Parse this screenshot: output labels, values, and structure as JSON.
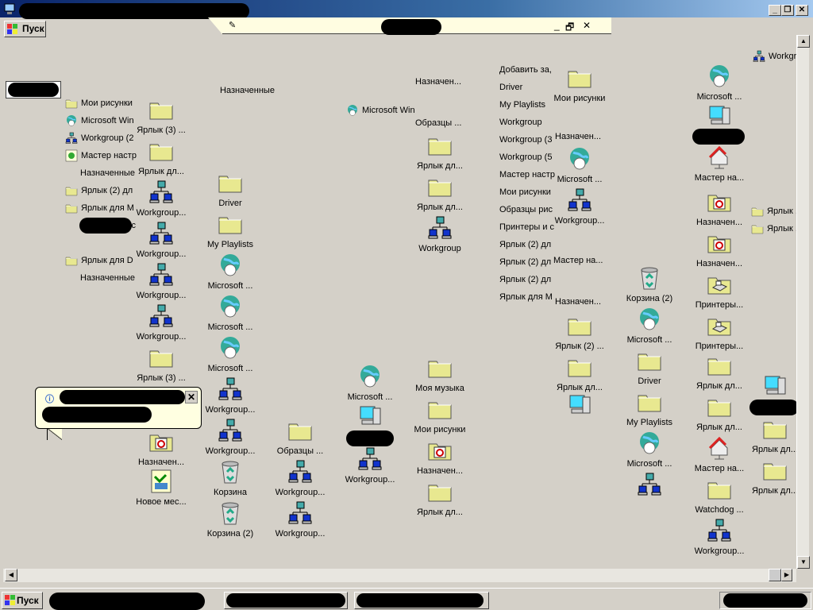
{
  "window": {
    "minimize": "_",
    "restore": "❐",
    "close": "✕"
  },
  "start": {
    "label": "Пуск"
  },
  "toolbar": {
    "minimize": "_",
    "restore": "🗗",
    "close": "✕"
  },
  "taskbar": {
    "start_label": "Пуск"
  },
  "balloon": {
    "close": "✕",
    "icon": "info-icon"
  },
  "text_items": [
    "Назначенные",
    "Назначен...",
    "Образцы ...",
    "Назначен...",
    "Мастер на...",
    "Назначен...",
    "Добавить за,",
    "Driver",
    "My Playlists",
    "Workgroup",
    "Workgroup (3",
    "Workgroup (5",
    "Мастер настр",
    "Мои рисунки",
    "Образцы рис",
    "Принтеры и с",
    "Ярлык (2) дл",
    "Ярлык (2) дл",
    "Ярлык (2) дл",
    "Ярлык для М",
    "Назначенные",
    "Назначенные"
  ],
  "small_icons": [
    {
      "label": "Мои рисунки",
      "icon": "folder"
    },
    {
      "label": "Microsoft Win",
      "icon": "globe"
    },
    {
      "label": "Workgroup (2",
      "icon": "network"
    },
    {
      "label": "Мастер настр",
      "icon": "wizard"
    },
    {
      "label": "Ярлык (2) дл",
      "icon": "folder"
    },
    {
      "label": "Ярлык для М",
      "icon": "folder"
    },
    {
      "label": "Принтеры и с",
      "icon": "none"
    },
    {
      "label": "Ярлык для D",
      "icon": "folder"
    },
    {
      "label": "Microsoft Win",
      "icon": "globe"
    },
    {
      "label": "Workgro",
      "icon": "network"
    },
    {
      "label": "Ярлык ,",
      "icon": "folder"
    },
    {
      "label": "Ярлык ,",
      "icon": "folder"
    }
  ],
  "large_icons": [
    {
      "label": "Ярлык (3) ...",
      "icon": "folder"
    },
    {
      "label": "Ярлык дл...",
      "icon": "folder"
    },
    {
      "label": "Workgroup...",
      "icon": "network"
    },
    {
      "label": "Workgroup...",
      "icon": "network"
    },
    {
      "label": "Workgroup...",
      "icon": "network"
    },
    {
      "label": "Workgroup...",
      "icon": "network"
    },
    {
      "label": "Ярлык (3) ...",
      "icon": "folder"
    },
    {
      "label": "Назначен...",
      "icon": "tasks"
    },
    {
      "label": "Новое мес...",
      "icon": "newplace"
    },
    {
      "label": "Driver",
      "icon": "folder"
    },
    {
      "label": "My Playlists",
      "icon": "folder"
    },
    {
      "label": "Microsoft ...",
      "icon": "globe"
    },
    {
      "label": "Microsoft ...",
      "icon": "globe"
    },
    {
      "label": "Microsoft ...",
      "icon": "globe"
    },
    {
      "label": "Workgroup...",
      "icon": "network"
    },
    {
      "label": "Workgroup...",
      "icon": "network"
    },
    {
      "label": "Корзина",
      "icon": "recycle"
    },
    {
      "label": "Корзина (2)",
      "icon": "recycle"
    },
    {
      "label": "Образцы ...",
      "icon": "folder"
    },
    {
      "label": "Workgroup...",
      "icon": "network"
    },
    {
      "label": "Workgroup...",
      "icon": "network"
    },
    {
      "label": "Microsoft ...",
      "icon": "globe"
    },
    {
      "label": "",
      "icon": "computer"
    },
    {
      "label": "Workgroup...",
      "icon": "network"
    },
    {
      "label": "Ярлык дл...",
      "icon": "folder"
    },
    {
      "label": "Ярлык дл...",
      "icon": "folder"
    },
    {
      "label": "Workgroup",
      "icon": "network"
    },
    {
      "label": "Моя музыка",
      "icon": "folder"
    },
    {
      "label": "Мои рисунки",
      "icon": "folder"
    },
    {
      "label": "Назначен...",
      "icon": "tasks"
    },
    {
      "label": "Ярлык дл...",
      "icon": "folder"
    },
    {
      "label": "Мои рисунки",
      "icon": "folder"
    },
    {
      "label": "Microsoft ...",
      "icon": "globe"
    },
    {
      "label": "Workgroup...",
      "icon": "network"
    },
    {
      "label": "Ярлык (2) ...",
      "icon": "folder"
    },
    {
      "label": "Ярлык дл...",
      "icon": "folder"
    },
    {
      "label": "",
      "icon": "computer"
    },
    {
      "label": "Корзина (2)",
      "icon": "recycle"
    },
    {
      "label": "Microsoft ...",
      "icon": "globe"
    },
    {
      "label": "Driver",
      "icon": "folder"
    },
    {
      "label": "My Playlists",
      "icon": "folder"
    },
    {
      "label": "Microsoft ...",
      "icon": "globe"
    },
    {
      "label": "",
      "icon": "network"
    },
    {
      "label": "Microsoft ...",
      "icon": "globe"
    },
    {
      "label": "",
      "icon": "computer"
    },
    {
      "label": "Мастер на...",
      "icon": "house"
    },
    {
      "label": "Назначен...",
      "icon": "tasks"
    },
    {
      "label": "Назначен...",
      "icon": "tasks"
    },
    {
      "label": "Принтеры...",
      "icon": "printers"
    },
    {
      "label": "Принтеры...",
      "icon": "printers"
    },
    {
      "label": "Ярлык дл...",
      "icon": "folder"
    },
    {
      "label": "Ярлык дл...",
      "icon": "folder"
    },
    {
      "label": "Мастер на...",
      "icon": "house"
    },
    {
      "label": "Watchdog ...",
      "icon": "folder"
    },
    {
      "label": "Workgroup...",
      "icon": "network"
    },
    {
      "label": "",
      "icon": "computer"
    },
    {
      "label": "Ярлык дл...",
      "icon": "folder"
    },
    {
      "label": "Ярлык дл...",
      "icon": "folder"
    }
  ]
}
